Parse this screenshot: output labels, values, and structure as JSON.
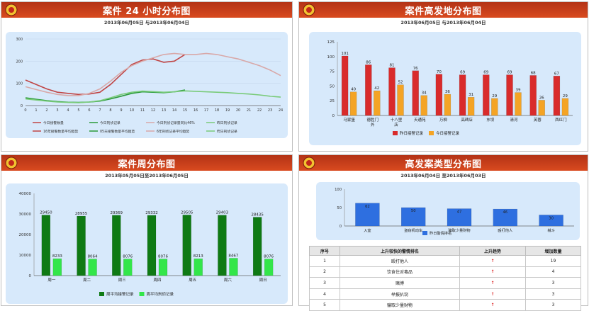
{
  "panels": {
    "hourly": {
      "title": "案件 24 小时分布图",
      "daterange": "2013年06月05日 与2013年06月04日",
      "chart_data": {
        "type": "line",
        "x": [
          0,
          1,
          2,
          3,
          4,
          5,
          6,
          7,
          8,
          9,
          10,
          11,
          12,
          13,
          14,
          15,
          16,
          17,
          18,
          19,
          20,
          21,
          22,
          23,
          24
        ],
        "ylim": [
          0,
          300
        ],
        "yticks": [
          0,
          100,
          200,
          300
        ],
        "series": [
          {
            "name": "今日接警数量",
            "color": "#c04545",
            "values": [
              115,
              95,
              75,
              60,
              55,
              50,
              52,
              60,
              95,
              140,
              185,
              205,
              210,
              195,
              200,
              230,
              null,
              null,
              null,
              null,
              null,
              null,
              null,
              null,
              null
            ]
          },
          {
            "name": "今日刑侦记录",
            "color": "#2a9a3a",
            "values": [
              35,
              28,
              22,
              18,
              15,
              14,
              16,
              20,
              30,
              42,
              55,
              62,
              60,
              58,
              62,
              70,
              null,
              null,
              null,
              null,
              null,
              null,
              null,
              null,
              null
            ]
          },
          {
            "name": "今日刑侦记录量同比46%",
            "color": "#d8a8a8",
            "values": [
              85,
              72,
              60,
              50,
              45,
              45,
              55,
              75,
              110,
              150,
              180,
              200,
              215,
              230,
              235,
              230,
              230,
              235,
              230,
              220,
              210,
              195,
              180,
              160,
              135
            ]
          },
          {
            "name": "昨日刑侦记录",
            "color": "#7acb7a",
            "values": [
              30,
              25,
              20,
              16,
              14,
              13,
              16,
              22,
              35,
              50,
              60,
              65,
              63,
              60,
              62,
              66,
              64,
              62,
              60,
              58,
              55,
              52,
              48,
              42,
              38
            ]
          }
        ],
        "legend": [
          "今日接警数量",
          "今日刑侦记录",
          "今日刑侦记录量同比46%",
          "昨日刑侦记录",
          "16年接警数量平均趋势",
          "05天接警数量平均趋势",
          "6年刑侦记录平均趋势",
          "昨日刑侦记录"
        ]
      }
    },
    "location": {
      "title": "案件高发地分布图",
      "daterange": "2013年06月05日 与2013年06月04日",
      "chart_data": {
        "type": "bar",
        "categories": [
          "马家堡",
          "德胜门外",
          "十八里店",
          "天通苑",
          "万柳",
          "高碑店",
          "东坝",
          "清河",
          "芙蓉",
          "西红门"
        ],
        "ylim": [
          0,
          125
        ],
        "yticks": [
          0,
          25,
          50,
          75,
          100,
          125
        ],
        "series": [
          {
            "name": "昨日接警记录",
            "color": "#d92b2b",
            "values": [
              101,
              86,
              81,
              76,
              70,
              69,
              69,
              69,
              68,
              67
            ]
          },
          {
            "name": "今日接警记录",
            "color": "#f4a425",
            "values": [
              40,
              42,
              52,
              34,
              36,
              31,
              29,
              39,
              26,
              29
            ]
          }
        ]
      }
    },
    "weekly": {
      "title": "案件周分布图",
      "daterange": "2013年05月05日至2013年06月05日",
      "chart_data": {
        "type": "bar",
        "categories": [
          "周一",
          "周二",
          "周三",
          "周四",
          "周五",
          "周六",
          "周日"
        ],
        "ylim": [
          0,
          40000
        ],
        "yticks": [
          0,
          10000,
          20000,
          30000,
          40000
        ],
        "series": [
          {
            "name": "周平均接警记录",
            "color": "#0f7a14",
            "values": [
              29450,
              28955,
              29369,
              29332,
              29505,
              29403,
              28435
            ]
          },
          {
            "name": "周平均刑侦记录",
            "color": "#33e64a",
            "values": [
              8233,
              8064,
              8076,
              8076,
              8213,
              8467,
              8076
            ]
          }
        ]
      }
    },
    "types": {
      "title": "高发案类型分布图",
      "daterange": "2013年06月04日 至2013年06月03日",
      "chart_data": {
        "type": "bar",
        "categories": [
          "入室",
          "盗窃机动车",
          "骗取少量财物",
          "殴打他人",
          "械斗"
        ],
        "ylim": [
          0,
          100
        ],
        "yticks": [
          0,
          50,
          100
        ],
        "series": [
          {
            "name": "昨日警情排名",
            "color": "#2e6fe0",
            "values": [
              62,
              50,
              47,
              46,
              30
            ]
          }
        ]
      },
      "table": {
        "headers": [
          "序号",
          "上升较快的警情排名",
          "上升趋势",
          "增加数量"
        ],
        "rows": [
          {
            "no": "1",
            "name": "殴打他人",
            "trend": "↑",
            "count": "19"
          },
          {
            "no": "2",
            "name": "饮食住对毒品",
            "trend": "↑",
            "count": "4"
          },
          {
            "no": "3",
            "name": "赌博",
            "trend": "↑",
            "count": "3"
          },
          {
            "no": "4",
            "name": "举报扒窃",
            "trend": "↑",
            "count": "3"
          },
          {
            "no": "5",
            "name": "骗取少量财物",
            "trend": "↑",
            "count": "3"
          }
        ]
      }
    }
  }
}
